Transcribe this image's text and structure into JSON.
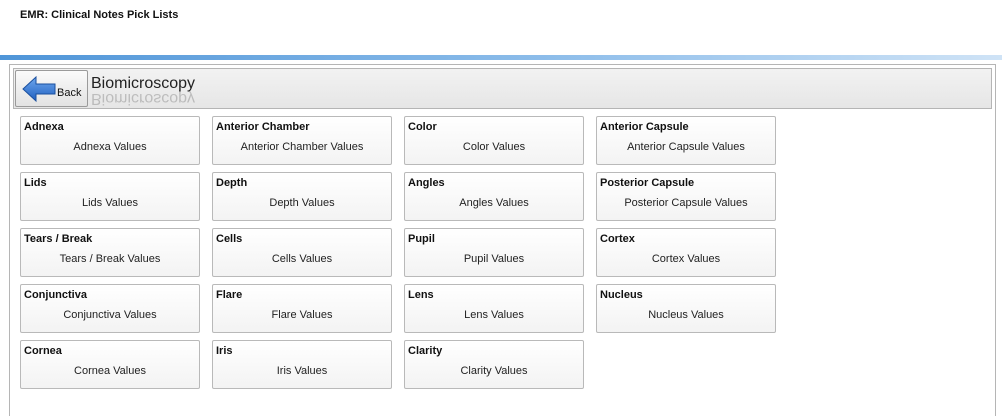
{
  "app": {
    "title": "EMR: Clinical Notes Pick Lists"
  },
  "toolbar": {
    "back_label": "Back",
    "screen_title": "Biomicroscopy"
  },
  "columns": [
    [
      {
        "name": "Adnexa",
        "value": "Adnexa Values"
      },
      {
        "name": "Lids",
        "value": "Lids Values"
      },
      {
        "name": "Tears / Break",
        "value": "Tears / Break Values"
      },
      {
        "name": "Conjunctiva",
        "value": "Conjunctiva Values"
      },
      {
        "name": "Cornea",
        "value": "Cornea Values"
      }
    ],
    [
      {
        "name": "Anterior Chamber",
        "value": "Anterior Chamber Values"
      },
      {
        "name": "Depth",
        "value": "Depth Values"
      },
      {
        "name": "Cells",
        "value": "Cells Values"
      },
      {
        "name": "Flare",
        "value": "Flare Values"
      },
      {
        "name": "Iris",
        "value": "Iris Values"
      }
    ],
    [
      {
        "name": "Color",
        "value": "Color Values"
      },
      {
        "name": "Angles",
        "value": "Angles Values"
      },
      {
        "name": "Pupil",
        "value": "Pupil Values"
      },
      {
        "name": "Lens",
        "value": "Lens Values"
      },
      {
        "name": "Clarity",
        "value": "Clarity Values"
      }
    ],
    [
      {
        "name": "Anterior Capsule",
        "value": "Anterior Capsule Values"
      },
      {
        "name": "Posterior Capsule",
        "value": "Posterior Capsule Values"
      },
      {
        "name": "Cortex",
        "value": "Cortex Values"
      },
      {
        "name": "Nucleus",
        "value": "Nucleus Values"
      }
    ]
  ],
  "icons": {
    "back": "back-arrow-icon"
  },
  "colors": {
    "accent": "#4f95d8",
    "arrow": "#2f6fc9"
  }
}
